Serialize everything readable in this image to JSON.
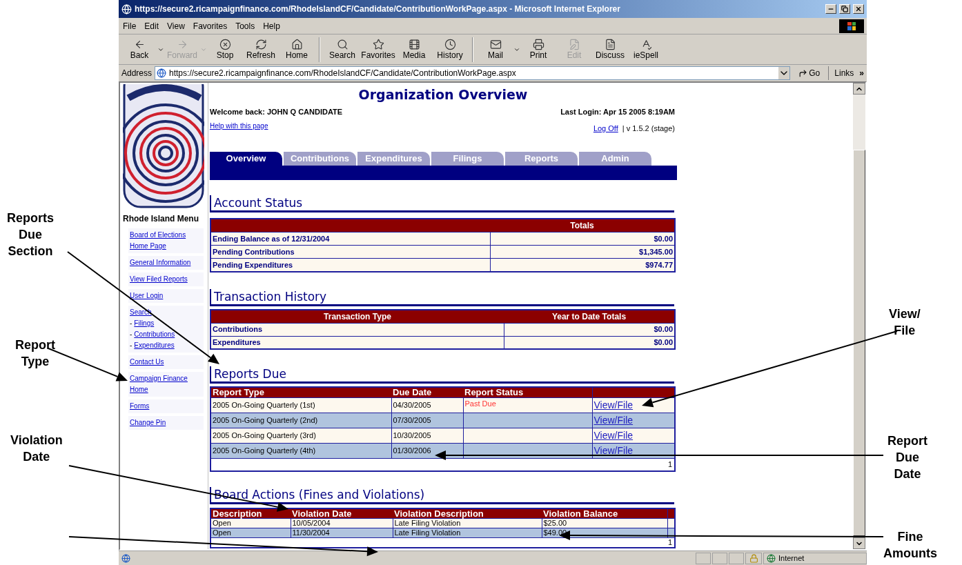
{
  "annotations": {
    "left": [
      {
        "text": "Reports Due Section"
      },
      {
        "text": "Report Type"
      },
      {
        "text": "Violation Date"
      }
    ],
    "right": [
      {
        "text": "View/ File"
      },
      {
        "text": "Report Due Date"
      },
      {
        "text": "Fine Amounts"
      }
    ]
  },
  "window": {
    "title": "https://secure2.ricampaignfinance.com/RhodeIslandCF/Candidate/ContributionWorkPage.aspx - Microsoft Internet Explorer"
  },
  "menu": [
    "File",
    "Edit",
    "View",
    "Favorites",
    "Tools",
    "Help"
  ],
  "toolbar": {
    "groups": [
      [
        {
          "label": "Back",
          "disabled": false,
          "dropdown": true
        },
        {
          "label": "Forward",
          "disabled": true,
          "dropdown": true
        },
        {
          "label": "Stop",
          "disabled": false,
          "dropdown": false
        },
        {
          "label": "Refresh",
          "disabled": false,
          "dropdown": false
        },
        {
          "label": "Home",
          "disabled": false,
          "dropdown": false
        }
      ],
      [
        {
          "label": "Search",
          "disabled": false,
          "dropdown": false
        },
        {
          "label": "Favorites",
          "disabled": false,
          "dropdown": false
        },
        {
          "label": "Media",
          "disabled": false,
          "dropdown": false
        },
        {
          "label": "History",
          "disabled": false,
          "dropdown": false
        }
      ],
      [
        {
          "label": "Mail",
          "disabled": false,
          "dropdown": true
        },
        {
          "label": "Print",
          "disabled": false,
          "dropdown": false
        },
        {
          "label": "Edit",
          "disabled": true,
          "dropdown": false
        },
        {
          "label": "Discuss",
          "disabled": false,
          "dropdown": false
        },
        {
          "label": "ieSpell",
          "disabled": false,
          "dropdown": false
        }
      ]
    ]
  },
  "address_bar": {
    "label": "Address",
    "url": "https://secure2.ricampaignfinance.com/RhodeIslandCF/Candidate/ContributionWorkPage.aspx",
    "go": "Go",
    "links": "Links",
    "links_more": "»"
  },
  "sidebar": {
    "title": "Rhode Island Menu",
    "groups": [
      {
        "items": [
          {
            "label": "Board of Elections Home Page"
          }
        ]
      },
      {
        "items": [
          {
            "label": "General Information"
          }
        ]
      },
      {
        "items": [
          {
            "label": "View Filed Reports"
          }
        ]
      },
      {
        "items": [
          {
            "label": "User Login"
          }
        ]
      },
      {
        "items": [
          {
            "label": "Search",
            "children": [
              {
                "bullet": "-",
                "label": "Filings"
              },
              {
                "bullet": "-",
                "label": "Contributions"
              },
              {
                "bullet": "-",
                "label": "Expenditures"
              }
            ]
          }
        ]
      },
      {
        "items": [
          {
            "label": "Contact Us"
          }
        ]
      },
      {
        "items": [
          {
            "label": "Campaign Finance Home"
          }
        ]
      },
      {
        "items": [
          {
            "label": "Forms"
          }
        ]
      },
      {
        "items": [
          {
            "label": "Change Pin"
          }
        ]
      }
    ]
  },
  "page": {
    "title": "Organization Overview",
    "welcome": "Welcome back: JOHN Q CANDIDATE",
    "last_login": "Last Login: Apr 15 2005 8:19AM",
    "help_link": "Help with this page",
    "log_off": "Log Off",
    "version": "| v 1.5.2 (stage)"
  },
  "tabs": [
    {
      "label": "Overview",
      "selected": true
    },
    {
      "label": "Contributions",
      "selected": false
    },
    {
      "label": "Expenditures",
      "selected": false
    },
    {
      "label": "Filings",
      "selected": false
    },
    {
      "label": "Reports",
      "selected": false
    },
    {
      "label": "Admin",
      "selected": false
    }
  ],
  "account_status": {
    "heading": "Account Status",
    "columns": [
      "",
      "Totals"
    ],
    "rows": [
      [
        "Ending Balance as of 12/31/2004",
        "$0.00"
      ],
      [
        "Pending Contributions",
        "$1,345.00"
      ],
      [
        "Pending Expenditures",
        "$974.77"
      ]
    ]
  },
  "transaction_history": {
    "heading": "Transaction History",
    "columns": [
      "Transaction Type",
      "Year to Date Totals"
    ],
    "rows": [
      [
        "Contributions",
        "$0.00"
      ],
      [
        "Expenditures",
        "$0.00"
      ]
    ]
  },
  "reports_due": {
    "heading": "Reports Due",
    "columns": [
      "Report Type",
      "Due Date",
      "Report Status"
    ],
    "rows": [
      {
        "type": "2005 On-Going Quarterly (1st)",
        "due": "04/30/2005",
        "status": "Past Due",
        "link": "View/File"
      },
      {
        "type": "2005 On-Going Quarterly (2nd)",
        "due": "07/30/2005",
        "link": "View/File"
      },
      {
        "type": "2005 On-Going Quarterly (3rd)",
        "due": "10/30/2005",
        "link": "View/File"
      },
      {
        "type": "2005 On-Going Quarterly (4th)",
        "due": "01/30/2006",
        "link": "View/File"
      }
    ],
    "pager": "1"
  },
  "board_actions": {
    "heading": "Board Actions (Fines and Violations)",
    "columns": [
      "Description",
      "Violation Date",
      "Violation Description",
      "Violation Balance"
    ],
    "rows": [
      [
        "Open",
        "10/05/2004",
        "Late Filing Violation",
        "$25.00"
      ],
      [
        "Open",
        "11/30/2004",
        "Late Filing Violation",
        "$49.00"
      ]
    ],
    "pager": "1"
  },
  "status_bar": {
    "zone": "Internet"
  }
}
